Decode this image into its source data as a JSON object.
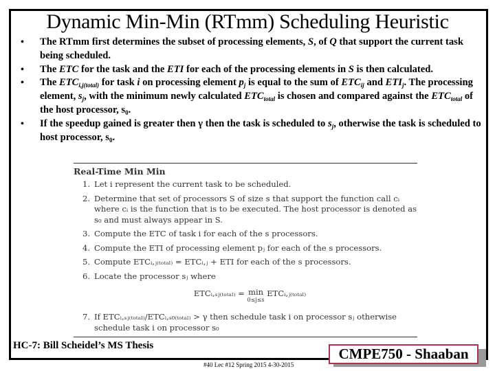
{
  "slide": {
    "title": "Dynamic Min-Min (RTmm) Scheduling Heuristic",
    "bullet_glyph": "•",
    "bullets": [
      {
        "parts": {
          "a": "The RTmm first determines the subset of processing elements, ",
          "b": "S",
          "c": ", of ",
          "d": "Q",
          "e": " that support the current task being scheduled."
        }
      },
      {
        "parts": {
          "a": "The ",
          "b": "ETC",
          "c": " for the task and the ",
          "d": "ETI",
          "e": " for each of the processing elements in ",
          "f": "S",
          "g": " is then calculated."
        }
      },
      {
        "parts": {
          "a": "The ",
          "b": "ETC",
          "b_sub": "i,j(total)",
          "c": " for task ",
          "d": "i",
          "e": " on processing element ",
          "f": "p",
          "f_sub": "j",
          "g": " is equal to the sum of ",
          "h": "ETC",
          "h_sub": "ij",
          "i": " and ",
          "j": "ETI",
          "j_sub": "j",
          "k": ".  The processing element, ",
          "l": "s",
          "l_sub": "j",
          "m": ", with the minimum newly calculated ",
          "n": "ETC",
          "n_sub": "total",
          "o": " is chosen and compared against the ",
          "p": "ETC",
          "p_sub": "total",
          "q": " of the host processor,  s",
          "q_sub": "0",
          "r": "."
        }
      },
      {
        "parts": {
          "a": " If the speedup gained is greater then ",
          "b": "γ",
          "c": " then the task is scheduled to ",
          "d": "s",
          "d_sub": "j",
          "e": ", otherwise the task is scheduled to host processor, s",
          "e_sub": "0",
          "f": "."
        }
      }
    ]
  },
  "algorithm": {
    "heading": "Real-Time Min Min",
    "steps": [
      {
        "num": "1.",
        "text": "Let i represent the current task to be scheduled."
      },
      {
        "num": "2.",
        "text": "Determine that set of processors S of size s that support the function call cᵢ where cᵢ is the function that is to be executed. The host processor is denoted as s₀ and must always appear in S."
      },
      {
        "num": "3.",
        "text": "Compute the ETC of task i for each of the s processors."
      },
      {
        "num": "4.",
        "text": "Compute the ETI of processing element pⱼ for each of the s processors."
      },
      {
        "num": "5.",
        "text": "Compute ETCᵢ,ⱼ₍ₜₒₜₐₗ₎ = ETCᵢ,ⱼ + ETI for each of the s processors."
      },
      {
        "num": "6.",
        "text": "Locate the processor sⱼ where"
      },
      {
        "num": "7.",
        "text": "If ETCᵢ,ₛⱼ₍ₜₒₜₐₗ₎/ETCᵢ,ₛ₀₍ₜₒₜₐₗ₎ > γ then schedule task i on processor sⱼ otherwise schedule task i on processor s₀"
      }
    ],
    "equation": {
      "lhs": "ETCᵢ,ₛⱼ₍ₜₒₜₐₗ₎ = ",
      "op": "min",
      "op_range": "0≤j≤s",
      "rhs": " ETCᵢ,ⱼ₍ₜₒₜₐₗ₎"
    }
  },
  "footer": {
    "source": "HC-7: Bill Scheidel’s MS Thesis",
    "meta": "#40  Lec #12  Spring 2015  4-30-2015",
    "badge": "CMPE750 - Shaaban",
    "badge_border_color": "#b03050"
  }
}
